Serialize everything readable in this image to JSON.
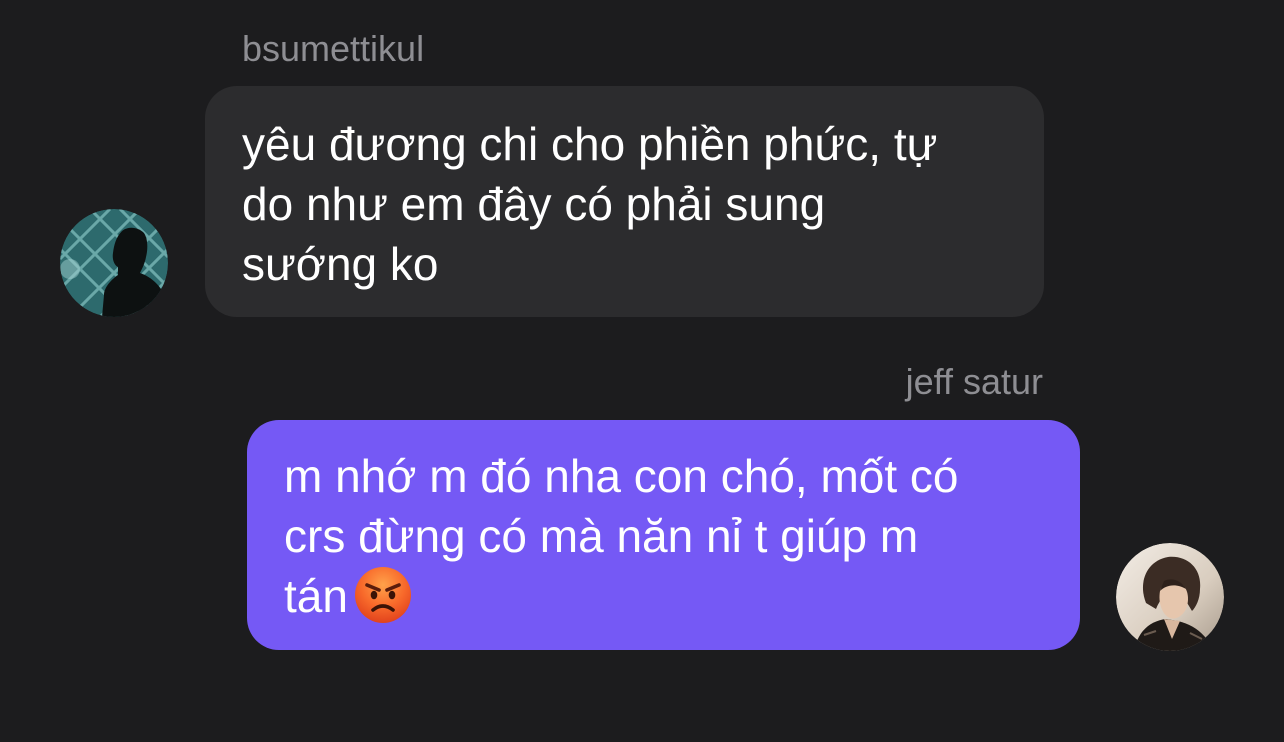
{
  "messages": [
    {
      "sender": "bsumettikul",
      "lines": [
        "yêu đương chi cho phiền phức, tự",
        "do như em đây có phải sung",
        "sướng ko"
      ],
      "bubble_color": "#2c2c2e",
      "avatar_icon": "silhouette-avatar-icon"
    },
    {
      "sender": "jeff satur",
      "lines": [
        "m nhớ m đó nha con chó, mốt có",
        "crs đừng có mà năn nỉ t giúp m",
        "tán"
      ],
      "emoji": "angry-face-emoji-icon",
      "bubble_color": "#7559f5",
      "avatar_icon": "profile-photo-avatar-icon"
    }
  ],
  "colors": {
    "background": "#1c1c1e",
    "sender_name": "#8e8e93",
    "message_text": "#ffffff"
  }
}
